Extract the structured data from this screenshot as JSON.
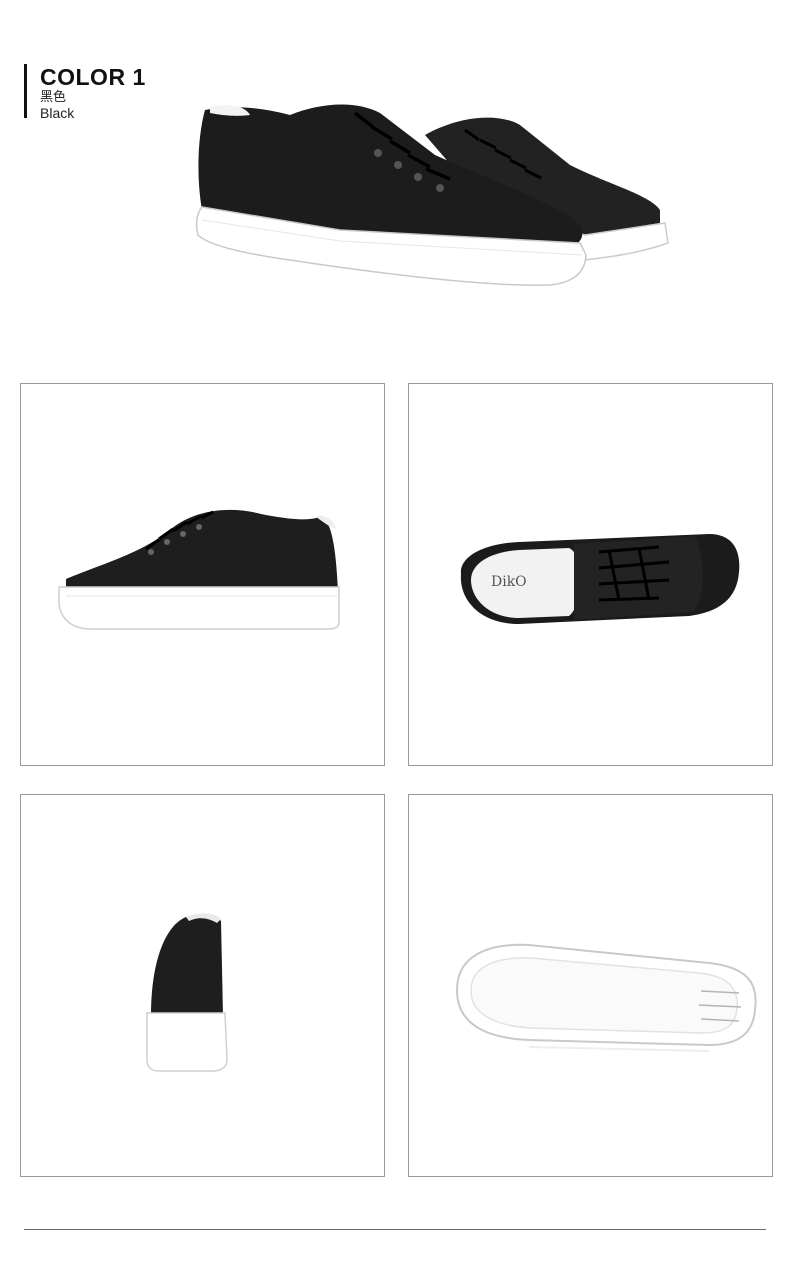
{
  "header": {
    "title": "COLOR 1",
    "color_cn": "黑色",
    "color_en": "Black"
  },
  "images": {
    "hero": "sneaker-pair",
    "side": "sneaker-side-view",
    "top": "sneaker-top-view",
    "back": "sneaker-back-view",
    "sole": "sneaker-sole-view"
  },
  "brand_mark": "DikO",
  "colors": {
    "upper": "#1c1c1c",
    "sole": "#ffffff",
    "frame_border": "#9a9a9a",
    "divider": "#6a6a6a"
  }
}
